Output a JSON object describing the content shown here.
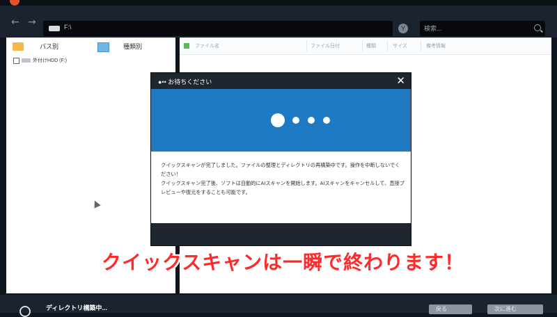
{
  "toolbar": {
    "back_icon": "arrow-left-icon",
    "forward_icon": "arrow-right-icon",
    "back_glyph": "←",
    "forward_glyph": "→",
    "address": "F:\\",
    "search_placeholder": "検索...",
    "filter_glyph": "Y"
  },
  "left_panel": {
    "tab_path": "パス別",
    "tab_type": "種類別",
    "tree_item": "外付けHDD (F:)"
  },
  "file_table": {
    "columns": [
      "ファイル名",
      "ファイル日付",
      "種類",
      "サイズ",
      "備考情報"
    ]
  },
  "modal": {
    "title": "●•• お待ちください",
    "close": "✕",
    "message_line1": "クイックスキャンが完了しました。ファイルの整理とディレクトリの再構築中です。操作を中断しないでください！",
    "message_line2": "クイックスキャン完了後、ソフトは自動的にAIスキャンを開始します。AIスキャンをキャンセルして、直接プレビューや復元をすることも可能です。"
  },
  "footer": {
    "status": "ディレクトリ構築中...",
    "back_label": "戻る",
    "next_label": "次に進む"
  },
  "caption": "クイックスキャンは一瞬で終わります！",
  "colors": {
    "accent_blue": "#1e7ac2",
    "caption_red": "#ff2b2b",
    "dark_bg": "#1b232e"
  }
}
